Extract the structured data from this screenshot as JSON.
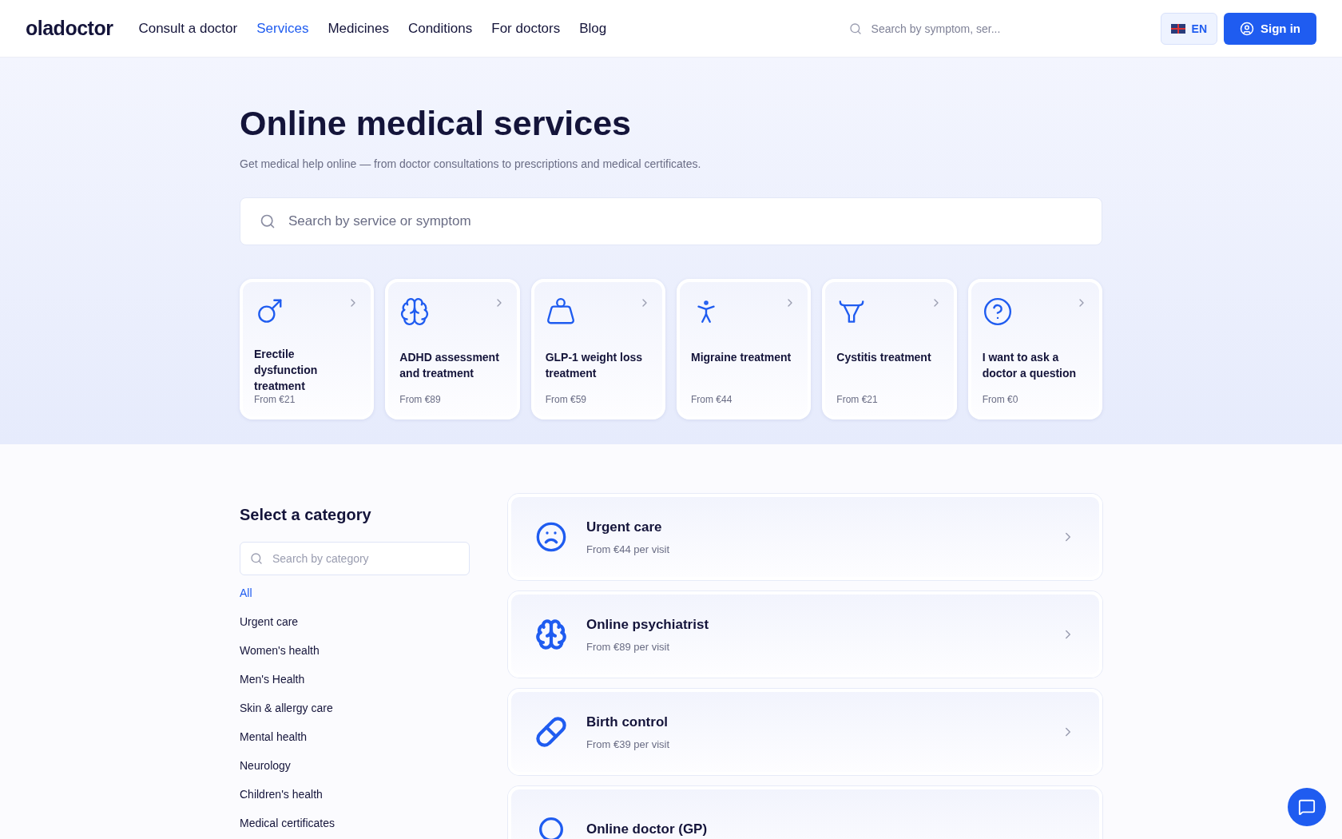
{
  "header": {
    "logo": "oladoctor",
    "nav": [
      {
        "label": "Consult a doctor",
        "selected": false
      },
      {
        "label": "Services",
        "selected": true
      },
      {
        "label": "Medicines",
        "selected": false
      },
      {
        "label": "Conditions",
        "selected": false
      },
      {
        "label": "For doctors",
        "selected": false
      },
      {
        "label": "Blog",
        "selected": false
      }
    ],
    "search": {
      "placeholder": "Search by symptom, ser..."
    },
    "language": "EN",
    "sign_in": "Sign in"
  },
  "hero": {
    "title": "Online medical services",
    "subtitle": "Get medical help online — from doctor consultations to prescriptions and medical certificates.",
    "search": {
      "placeholder": "Search by service or symptom"
    },
    "cards": [
      {
        "title": "Erectile dysfunction treatment",
        "price": "From €21"
      },
      {
        "title": "ADHD assessment and treatment",
        "price": "From €89"
      },
      {
        "title": "GLP-1 weight loss treatment",
        "price": "From €59"
      },
      {
        "title": "Migraine treatment",
        "price": "From €44"
      },
      {
        "title": "Cystitis treatment",
        "price": "From €21"
      },
      {
        "title": "I want to ask a doctor a question",
        "price": "From €0"
      }
    ]
  },
  "categories": {
    "title": "Select a category",
    "search": {
      "placeholder": "Search by category"
    },
    "items": [
      {
        "label": "All",
        "selected": true
      },
      {
        "label": "Urgent care",
        "selected": false
      },
      {
        "label": "Women's health",
        "selected": false
      },
      {
        "label": "Men's Health",
        "selected": false
      },
      {
        "label": "Skin & allergy care",
        "selected": false
      },
      {
        "label": "Mental health",
        "selected": false
      },
      {
        "label": "Neurology",
        "selected": false
      },
      {
        "label": "Children's health",
        "selected": false
      },
      {
        "label": "Medical certificates",
        "selected": false
      }
    ]
  },
  "services": [
    {
      "title": "Urgent care",
      "price": "From €44 per visit"
    },
    {
      "title": "Online psychiatrist",
      "price": "From €89 per visit"
    },
    {
      "title": "Birth control",
      "price": "From €39 per visit"
    },
    {
      "title": "Online doctor (GP)"
    }
  ]
}
